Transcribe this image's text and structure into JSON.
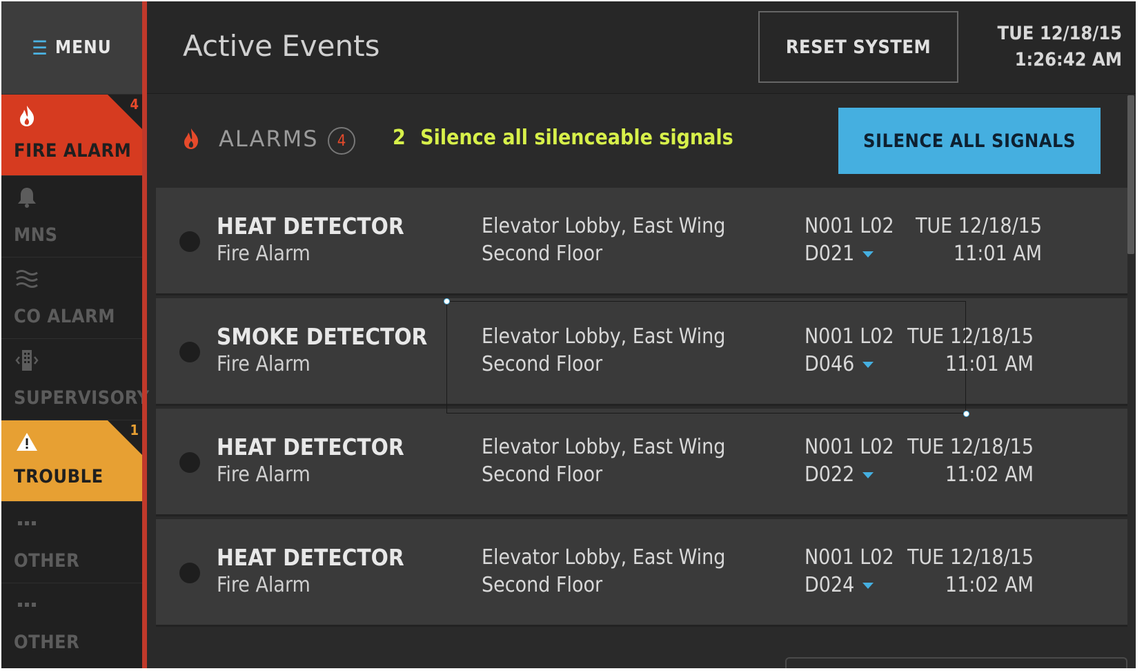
{
  "menu": {
    "icon": "hamburger-icon",
    "label": "MENU"
  },
  "sidebar": {
    "items": [
      {
        "label": "FIRE ALARM",
        "icon": "flame-icon",
        "badge": "4"
      },
      {
        "label": "MNS",
        "icon": "bell-icon"
      },
      {
        "label": "CO ALARM",
        "icon": "waves-icon"
      },
      {
        "label": "SUPERVISORY",
        "icon": "building-icon"
      },
      {
        "label": "TROUBLE",
        "icon": "warning-icon",
        "badge": "1"
      },
      {
        "label": "OTHER",
        "icon": "ellipsis-icon"
      },
      {
        "label": "OTHER",
        "icon": "ellipsis-icon"
      }
    ]
  },
  "header": {
    "title": "Active Events",
    "reset_label": "RESET SYSTEM",
    "date": "TUE 12/18/15",
    "time": "1:26:42 AM"
  },
  "alarms": {
    "label": "ALARMS",
    "count": "4",
    "silence_count": "2",
    "silence_message": "Silence all silenceable signals",
    "silence_button": "SILENCE ALL SIGNALS"
  },
  "events": [
    {
      "type": "HEAT DETECTOR",
      "category": "Fire Alarm",
      "location1": "Elevator Lobby, East Wing",
      "location2": "Second Floor",
      "address1": "N001 L02",
      "address2": "D021",
      "date": "TUE 12/18/15",
      "time": "11:01 AM"
    },
    {
      "type": "SMOKE DETECTOR",
      "category": "Fire Alarm",
      "location1": "Elevator Lobby, East Wing",
      "location2": "Second Floor",
      "address1": "N001 L02",
      "address2": "D046",
      "date": "TUE 12/18/15",
      "time": "11:01 AM"
    },
    {
      "type": "HEAT DETECTOR",
      "category": "Fire Alarm",
      "location1": "Elevator Lobby, East Wing",
      "location2": "Second Floor",
      "address1": "N001 L02",
      "address2": "D022",
      "date": "TUE 12/18/15",
      "time": "11:02 AM"
    },
    {
      "type": "HEAT DETECTOR",
      "category": "Fire Alarm",
      "location1": "Elevator Lobby, East Wing",
      "location2": "Second Floor",
      "address1": "N001 L02",
      "address2": "D024",
      "date": "TUE 12/18/15",
      "time": "11:02 AM"
    }
  ],
  "colors": {
    "fire": "#d63b20",
    "trouble": "#e7a033",
    "accent": "#45afe0",
    "silence_text": "#d7f04a"
  }
}
